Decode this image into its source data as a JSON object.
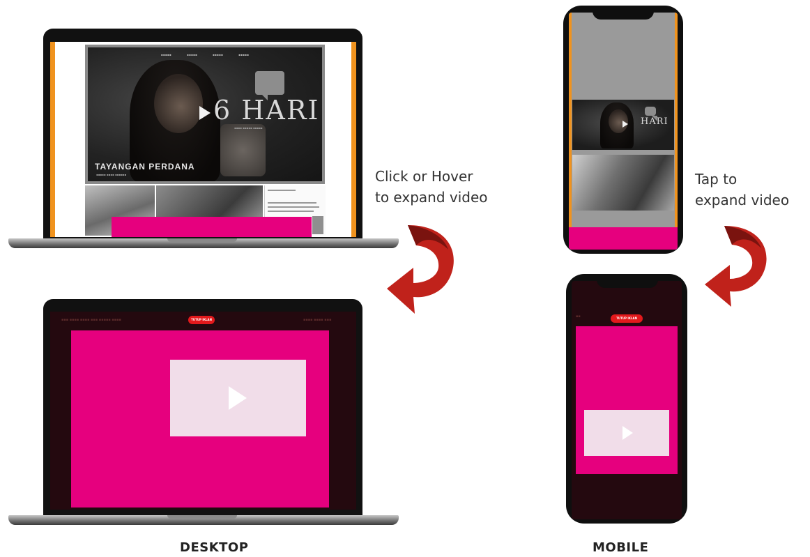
{
  "desktop": {
    "label": "DESKTOP",
    "caption_line1": "Click or Hover",
    "caption_line2": "to expand video",
    "hero_title": "6 HARI",
    "hero_subtitle": "TAYANGAN PERDANA",
    "expanded_pill": "TUTUP IKLAN"
  },
  "mobile": {
    "label": "MOBILE",
    "caption_line1": "Tap to",
    "caption_line2": "expand video",
    "hero_title": "HARI",
    "expanded_pill": "TUTUP IKLAN"
  },
  "colors": {
    "ad_pink": "#e6007e",
    "video_placeholder": "#f1dde9",
    "accent_orange": "#f0931e",
    "arrow_red": "#c0221b",
    "expanded_background": "#24090f",
    "close_pill": "#e3191c"
  },
  "icons": {
    "play": "play-icon",
    "arrow": "curved-arrow-icon",
    "speech_bubble": "speech-bubble-icon"
  }
}
